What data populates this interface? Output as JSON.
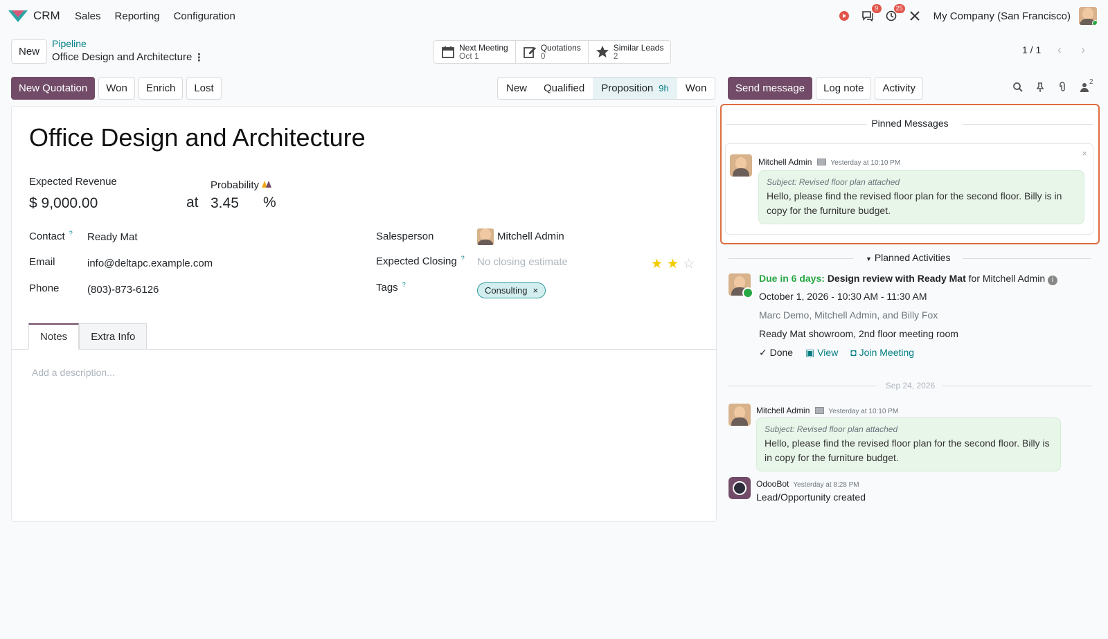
{
  "navbar": {
    "app_name": "CRM",
    "menu": [
      "Sales",
      "Reporting",
      "Configuration"
    ],
    "messages_count": "9",
    "activities_count": "25",
    "company": "My Company (San Francisco)"
  },
  "control": {
    "new_label": "New",
    "breadcrumb_parent": "Pipeline",
    "breadcrumb_current": "Office Design and Architecture",
    "pager": "1 / 1"
  },
  "smart_buttons": [
    {
      "title": "Next Meeting",
      "value": "Oct 1"
    },
    {
      "title": "Quotations",
      "value": "0"
    },
    {
      "title": "Similar Leads",
      "value": "2"
    }
  ],
  "actions": [
    "New Quotation",
    "Won",
    "Enrich",
    "Lost"
  ],
  "stages": [
    {
      "label": "New"
    },
    {
      "label": "Qualified"
    },
    {
      "label": "Proposition",
      "duration": "9h"
    },
    {
      "label": "Won"
    }
  ],
  "chatter_actions": [
    "Send message",
    "Log note",
    "Activity"
  ],
  "followers_count": "2",
  "form": {
    "title": "Office Design and Architecture",
    "expected_revenue_label": "Expected Revenue",
    "expected_revenue": "$ 9,000.00",
    "at": "at",
    "probability_label": "Probability",
    "probability": "3.45",
    "percent": "%",
    "contact_label": "Contact",
    "contact": "Ready Mat",
    "email_label": "Email",
    "email": "info@deltapc.example.com",
    "phone_label": "Phone",
    "phone": "(803)-873-6126",
    "salesperson_label": "Salesperson",
    "salesperson": "Mitchell Admin",
    "closing_label": "Expected Closing",
    "closing_placeholder": "No closing estimate",
    "tags_label": "Tags",
    "tag": "Consulting",
    "priority_stars": 2,
    "help_mark": "?",
    "tabs": [
      "Notes",
      "Extra Info"
    ],
    "description_placeholder": "Add a description..."
  },
  "pinned": {
    "header": "Pinned Messages",
    "author": "Mitchell Admin",
    "date": "Yesterday at 10:10 PM",
    "subject": "Subject: Revised floor plan attached",
    "body": "Hello, please find the revised floor plan for the second floor. Billy is in copy for the furniture budget."
  },
  "planned": {
    "header": "Planned Activities",
    "due": "Due in 6 days:",
    "summary": "Design review with Ready Mat",
    "for_text": "for Mitchell Admin",
    "datetime": "October 1, 2026 - 10:30 AM - 11:30 AM",
    "attendees": "Marc Demo, Mitchell Admin, and Billy Fox",
    "location": "Ready Mat showroom, 2nd floor meeting room",
    "done": "Done",
    "view": "View",
    "join": "Join Meeting"
  },
  "thread": {
    "date_sep": "Sep 24, 2026",
    "msg1_author": "Mitchell Admin",
    "msg1_date": "Yesterday at 10:10 PM",
    "msg1_subject": "Subject: Revised floor plan attached",
    "msg1_body": "Hello, please find the revised floor plan for the second floor. Billy is in copy for the furniture budget.",
    "msg2_author": "OdooBot",
    "msg2_date": "Yesterday at 8:28 PM",
    "msg2_body": "Lead/Opportunity created"
  }
}
